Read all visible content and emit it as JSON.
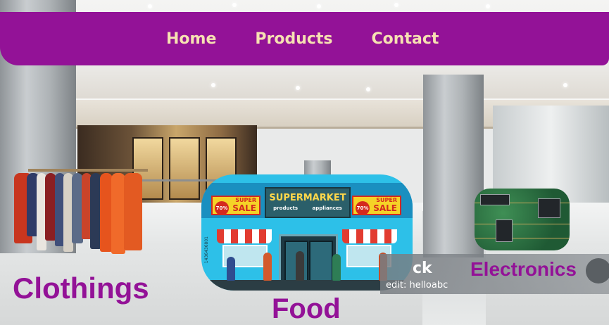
{
  "nav": {
    "items": [
      "Home",
      "Products",
      "Contact"
    ]
  },
  "categories": {
    "clothings": "Clothings",
    "food": "Food",
    "electronics": "Electronics"
  },
  "supermarket_image": {
    "sign_title": "SUPERMARKET",
    "sign_left": "products",
    "sign_right": "appliances",
    "sale_text": "SALE",
    "super_text": "SUPER",
    "percent": "70%",
    "side_code": "1436436801"
  },
  "credit_strip": {
    "brand_fragment": "ck",
    "credit_text": "edit: helloabc"
  },
  "colors": {
    "brand": "#931297",
    "nav_text": "#f6e1b2"
  }
}
